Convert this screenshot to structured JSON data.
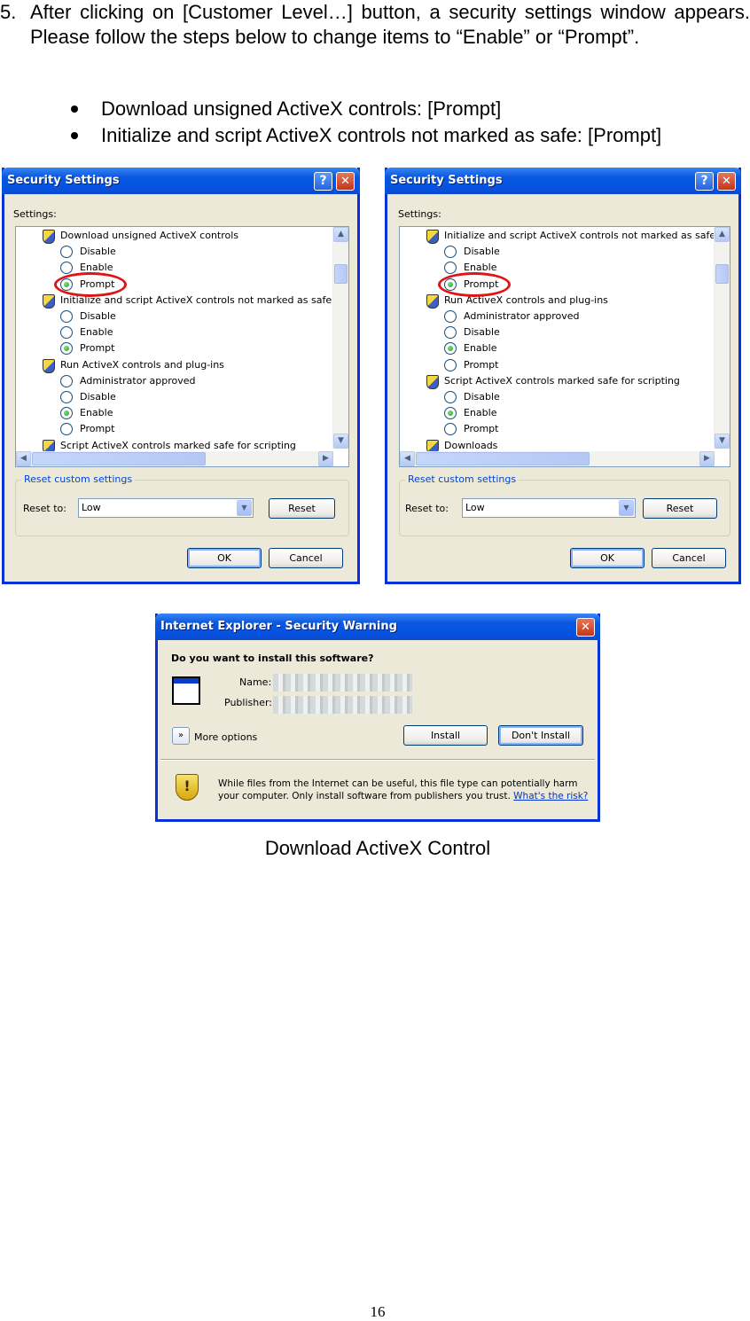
{
  "intro": {
    "step_number": "5.",
    "paragraph": "After clicking on [Customer Level…] button, a security settings window appears. Please follow the steps below to change items to “Enable” or “Prompt”.",
    "bullets": [
      "Download unsigned ActiveX controls: [Prompt]",
      "Initialize and script ActiveX controls not marked as safe: [Prompt]"
    ]
  },
  "dialog_left": {
    "title": "Security Settings",
    "help_glyph": "?",
    "close_glyph": "✕",
    "settings_label": "Settings:",
    "items": [
      {
        "type": "header",
        "text": "Download unsigned ActiveX controls"
      },
      {
        "type": "option",
        "text": "Disable",
        "checked": false
      },
      {
        "type": "option",
        "text": "Enable",
        "checked": false
      },
      {
        "type": "option",
        "text": "Prompt",
        "checked": true
      },
      {
        "type": "header",
        "text": "Initialize and script ActiveX controls not marked as safe"
      },
      {
        "type": "option",
        "text": "Disable",
        "checked": false
      },
      {
        "type": "option",
        "text": "Enable",
        "checked": false
      },
      {
        "type": "option",
        "text": "Prompt",
        "checked": true
      },
      {
        "type": "header",
        "text": "Run ActiveX controls and plug-ins"
      },
      {
        "type": "option",
        "text": "Administrator approved",
        "checked": false
      },
      {
        "type": "option",
        "text": "Disable",
        "checked": false
      },
      {
        "type": "option",
        "text": "Enable",
        "checked": true
      },
      {
        "type": "option",
        "text": "Prompt",
        "checked": false
      },
      {
        "type": "header",
        "text": "Script ActiveX controls marked safe for scripting"
      }
    ],
    "reset_group_title": "Reset custom settings",
    "reset_to_label": "Reset to:",
    "reset_to_value": "Low",
    "reset_button": "Reset",
    "ok_button": "OK",
    "cancel_button": "Cancel"
  },
  "dialog_right": {
    "title": "Security Settings",
    "help_glyph": "?",
    "close_glyph": "✕",
    "settings_label": "Settings:",
    "items": [
      {
        "type": "header",
        "text": "Initialize and script ActiveX controls not marked as safe"
      },
      {
        "type": "option",
        "text": "Disable",
        "checked": false
      },
      {
        "type": "option",
        "text": "Enable",
        "checked": false
      },
      {
        "type": "option",
        "text": "Prompt",
        "checked": true
      },
      {
        "type": "header",
        "text": "Run ActiveX controls and plug-ins"
      },
      {
        "type": "option",
        "text": "Administrator approved",
        "checked": false
      },
      {
        "type": "option",
        "text": "Disable",
        "checked": false
      },
      {
        "type": "option",
        "text": "Enable",
        "checked": true
      },
      {
        "type": "option",
        "text": "Prompt",
        "checked": false
      },
      {
        "type": "header",
        "text": "Script ActiveX controls marked safe for scripting"
      },
      {
        "type": "option",
        "text": "Disable",
        "checked": false
      },
      {
        "type": "option",
        "text": "Enable",
        "checked": true
      },
      {
        "type": "option",
        "text": "Prompt",
        "checked": false
      },
      {
        "type": "header",
        "text": "Downloads"
      }
    ],
    "reset_group_title": "Reset custom settings",
    "reset_to_label": "Reset to:",
    "reset_to_value": "Low",
    "reset_button": "Reset",
    "ok_button": "OK",
    "cancel_button": "Cancel"
  },
  "warning_dialog": {
    "title": "Internet Explorer - Security Warning",
    "close_glyph": "✕",
    "question": "Do you want to install this software?",
    "name_label": "Name:",
    "publisher_label": "Publisher:",
    "more_options": "More options",
    "install_button": "Install",
    "dont_install_button": "Don't Install",
    "info_text_line1": "While files from the Internet can be useful, this file type can potentially harm",
    "info_text_line2": "your computer. Only install software from publishers you trust.",
    "risk_link": "What's the risk?"
  },
  "caption": "Download ActiveX Control",
  "page_number": "16"
}
